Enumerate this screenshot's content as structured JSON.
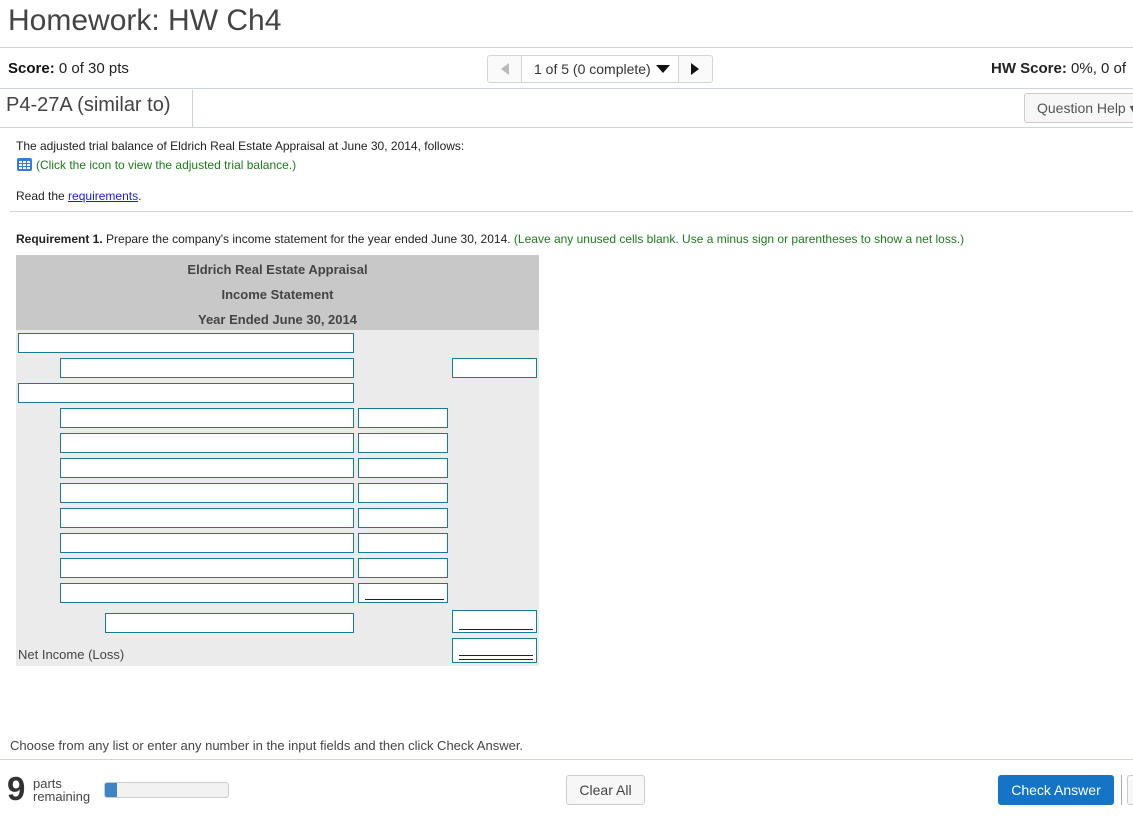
{
  "header": {
    "title": "Homework: HW Ch4",
    "score_label": "Score:",
    "score_value": "0 of 30 pts",
    "hw_score_label": "HW Score:",
    "hw_score_value": "0%, 0 of"
  },
  "navigator": {
    "prev_icon": "triangle-left-icon",
    "position": "1 of 5 (0 complete)",
    "dropdown_icon": "caret-down-icon",
    "next_icon": "triangle-right-icon"
  },
  "question": {
    "id": "P4-27A (similar to)",
    "help_button": "Question Help ▾"
  },
  "problem": {
    "intro": "The adjusted trial balance of Eldrich Real Estate Appraisal at June 30, 2014, follows:",
    "icon_hint": "(Click the icon to view the adjusted trial balance.)",
    "read_prefix": "Read the ",
    "requirements_link": "requirements",
    "read_suffix": ".",
    "requirement_label": "Requirement 1.",
    "requirement_text": " Prepare the company's income statement for the year ended June 30, 2014. ",
    "requirement_note": "(Leave any unused cells blank. Use a minus sign or parentheses to show a net loss.)"
  },
  "statement": {
    "company": "Eldrich Real Estate Appraisal",
    "name": "Income Statement",
    "period": "Year Ended June 30, 2014",
    "net_income_label": "Net Income (Loss)",
    "fields": {
      "row1_label": "",
      "row2_label": "",
      "row2_total": "",
      "row3_label": "",
      "expense_labels": [
        "",
        "",
        "",
        "",
        "",
        "",
        "",
        ""
      ],
      "expense_amounts": [
        "",
        "",
        "",
        "",
        "",
        "",
        "",
        ""
      ],
      "total_label": "",
      "total_amount": "",
      "net_income_amount": ""
    }
  },
  "footer": {
    "instructions": "Choose from any list or enter any number in the input fields and then click Check Answer.",
    "parts_count": "9",
    "parts_label_1": "parts",
    "parts_label_2": "remaining",
    "progress_fraction": 0.1,
    "clear_all": "Clear All",
    "check_answer": "Check Answer"
  },
  "colors": {
    "accent_blue": "#1574c6",
    "hint_green": "#1e7a1e",
    "input_border": "#1a7a96",
    "progress_fill": "#3d85c6"
  }
}
